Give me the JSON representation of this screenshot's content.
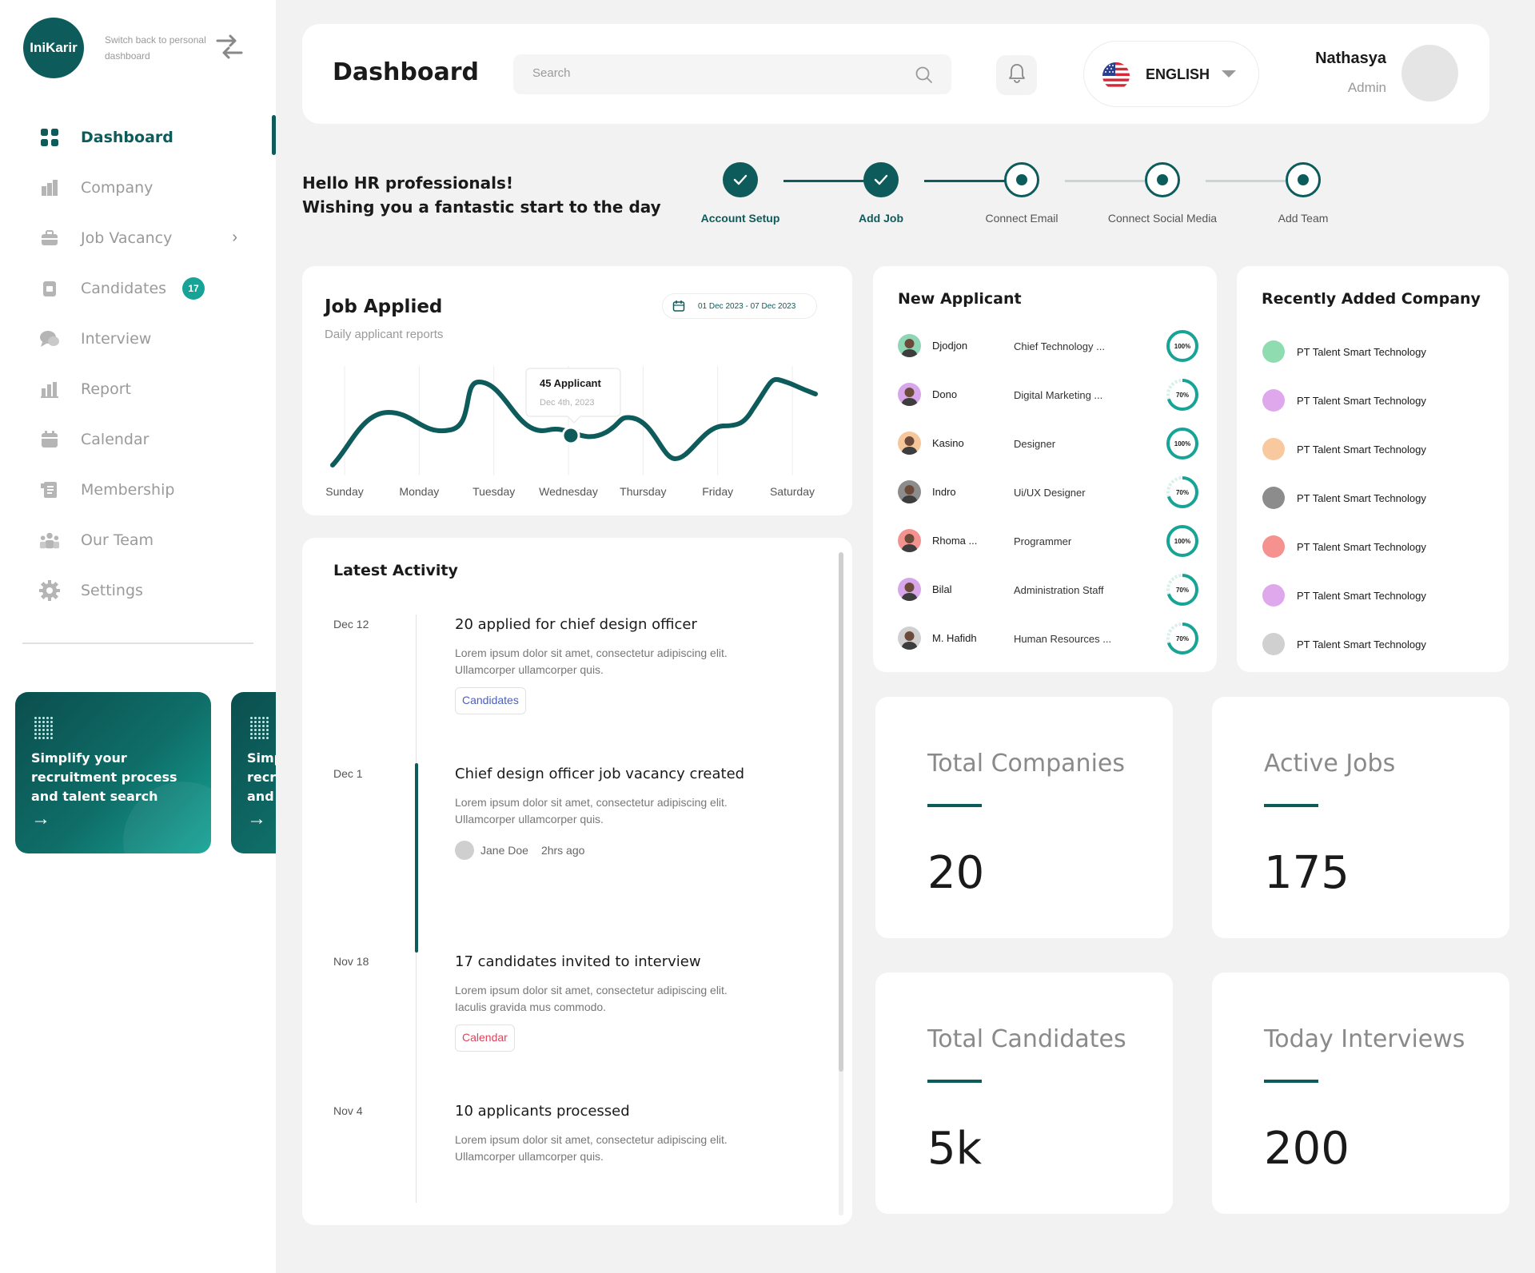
{
  "app": {
    "logo_text": "IniKarir",
    "switch_text": "Switch back to personal dashboard"
  },
  "sidebar": {
    "items": [
      {
        "label": "Dashboard",
        "icon": "grid-icon",
        "active": true
      },
      {
        "label": "Company",
        "icon": "building-icon"
      },
      {
        "label": "Job Vacancy",
        "icon": "briefcase-icon",
        "has_submenu": true
      },
      {
        "label": "Candidates",
        "icon": "clipboard-icon",
        "badge": "17"
      },
      {
        "label": "Interview",
        "icon": "chat-icon"
      },
      {
        "label": "Report",
        "icon": "bar-chart-icon"
      },
      {
        "label": "Calendar",
        "icon": "calendar-icon"
      },
      {
        "label": "Membership",
        "icon": "document-icon"
      },
      {
        "label": "Our Team",
        "icon": "team-icon"
      },
      {
        "label": "Settings",
        "icon": "gear-icon"
      }
    ],
    "promo": {
      "text": "Simplify your recruitment process and talent search",
      "arrow": "→"
    }
  },
  "header": {
    "title": "Dashboard",
    "search_placeholder": "Search",
    "language": "ENGLISH",
    "user_name": "Nathasya",
    "user_role": "Admin"
  },
  "greeting": {
    "line1": "Hello HR professionals!",
    "line2": "Wishing you a fantastic start to the day"
  },
  "steps": [
    {
      "label": "Account Setup",
      "done": true
    },
    {
      "label": "Add Job",
      "done": true
    },
    {
      "label": "Connect Email",
      "done": false
    },
    {
      "label": "Connect Social Media",
      "done": false
    },
    {
      "label": "Add Team",
      "done": false
    }
  ],
  "job_applied": {
    "title": "Job Applied",
    "subtitle": "Daily applicant reports",
    "date_range": "01 Dec 2023 - 07 Dec 2023",
    "tooltip_title": "45 Applicant",
    "tooltip_date": "Dec 4th, 2023"
  },
  "chart_data": {
    "type": "line",
    "categories": [
      "Sunday",
      "Monday",
      "Tuesday",
      "Wednesday",
      "Thursday",
      "Friday",
      "Saturday"
    ],
    "highlight": {
      "category": "Wednesday",
      "value": 45,
      "label": "45 Applicant",
      "date": "Dec 4th, 2023"
    },
    "color": "#0e5b5b",
    "grid": "vertical lines",
    "legend": "none"
  },
  "activity": {
    "title": "Latest Activity",
    "items": [
      {
        "date": "Dec 12",
        "title": "20 applied for chief design officer",
        "desc": "Lorem ipsum dolor sit amet, consectetur adipiscing elit. Ullamcorper ullamcorper quis.",
        "tag": "Candidates"
      },
      {
        "date": "Dec 1",
        "title": "Chief design officer job vacancy created",
        "desc": "Lorem ipsum dolor sit amet, consectetur adipiscing elit. Ullamcorper ullamcorper quis.",
        "person": "Jane Doe",
        "time": "2hrs ago"
      },
      {
        "date": "Nov 18",
        "title": "17 candidates invited to interview",
        "desc": "Lorem ipsum dolor sit amet, consectetur adipiscing elit. Iaculis gravida mus commodo.",
        "tag": "Calendar"
      },
      {
        "date": "Nov 4",
        "title": "10 applicants processed",
        "desc": "Lorem ipsum dolor sit amet, consectetur adipiscing elit. Ullamcorper ullamcorper quis."
      }
    ]
  },
  "new_applicant": {
    "title": "New Applicant",
    "items": [
      {
        "name": "Djodjon",
        "role": "Chief Technology ...",
        "progress": "100%",
        "progress_value": 1.0,
        "avatar_color": "#8fd6b5"
      },
      {
        "name": "Dono",
        "role": "Digital Marketing ...",
        "progress": "70%",
        "progress_value": 0.7,
        "avatar_color": "#d8a6ea"
      },
      {
        "name": "Kasino",
        "role": "Designer",
        "progress": "100%",
        "progress_value": 1.0,
        "avatar_color": "#f5c79a"
      },
      {
        "name": "Indro",
        "role": "Ui/UX Designer",
        "progress": "70%",
        "progress_value": 0.7,
        "avatar_color": "#8c8c8c"
      },
      {
        "name": "Rhoma ...",
        "role": "Programmer",
        "progress": "100%",
        "progress_value": 1.0,
        "avatar_color": "#f3938f"
      },
      {
        "name": "Bilal",
        "role": "Administration Staff",
        "progress": "70%",
        "progress_value": 0.7,
        "avatar_color": "#d8a6ea"
      },
      {
        "name": "M. Hafidh",
        "role": "Human Resources ...",
        "progress": "70%",
        "progress_value": 0.7,
        "avatar_color": "#d0d0d0"
      }
    ]
  },
  "recent_companies": {
    "title": "Recently Added Company",
    "items": [
      {
        "name": "PT Talent Smart Technology",
        "color": "#8fdcb0"
      },
      {
        "name": "PT Talent Smart Technology",
        "color": "#dfa8ec"
      },
      {
        "name": "PT Talent Smart Technology",
        "color": "#f8c99e"
      },
      {
        "name": "PT Talent Smart Technology",
        "color": "#8c8c8c"
      },
      {
        "name": "PT Talent Smart Technology",
        "color": "#f5918f"
      },
      {
        "name": "PT Talent Smart Technology",
        "color": "#dfa8ec"
      },
      {
        "name": "PT Talent Smart Technology",
        "color": "#d0d0d0"
      }
    ]
  },
  "stats": [
    {
      "label": "Total Companies",
      "value": "20"
    },
    {
      "label": "Active Jobs",
      "value": "175"
    },
    {
      "label": "Total Candidates",
      "value": "5k"
    },
    {
      "label": "Today Interviews",
      "value": "200"
    }
  ],
  "colors": {
    "primary": "#0e5b5b",
    "accent": "#17a497",
    "background": "#f2f2f2"
  }
}
